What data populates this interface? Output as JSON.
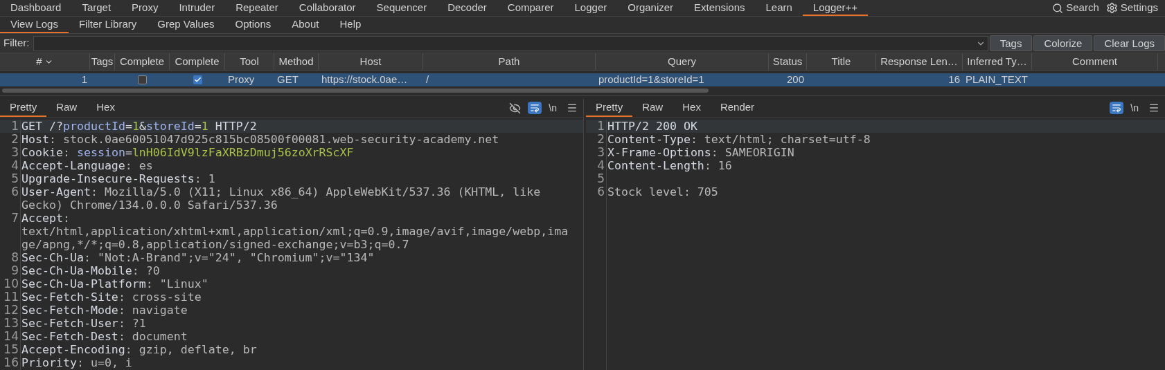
{
  "main_tabs": [
    {
      "label": "Dashboard",
      "selected": false
    },
    {
      "label": "Target",
      "selected": false
    },
    {
      "label": "Proxy",
      "selected": false
    },
    {
      "label": "Intruder",
      "selected": false
    },
    {
      "label": "Repeater",
      "selected": false
    },
    {
      "label": "Collaborator",
      "selected": false
    },
    {
      "label": "Sequencer",
      "selected": false
    },
    {
      "label": "Decoder",
      "selected": false
    },
    {
      "label": "Comparer",
      "selected": false
    },
    {
      "label": "Logger",
      "selected": false
    },
    {
      "label": "Organizer",
      "selected": false
    },
    {
      "label": "Extensions",
      "selected": false
    },
    {
      "label": "Learn",
      "selected": false
    },
    {
      "label": "Logger++",
      "selected": true
    }
  ],
  "top_actions": [
    {
      "kind": "search",
      "label": "Search"
    },
    {
      "kind": "settings",
      "label": "Settings"
    }
  ],
  "sub_tabs": [
    {
      "label": "View Logs",
      "selected": true
    },
    {
      "label": "Filter Library",
      "selected": false
    },
    {
      "label": "Grep Values",
      "selected": false
    },
    {
      "label": "Options",
      "selected": false
    },
    {
      "label": "About",
      "selected": false
    },
    {
      "label": "Help",
      "selected": false
    }
  ],
  "filter": {
    "label": "Filter:",
    "buttons": [
      "Tags",
      "Colorize",
      "Clear Logs"
    ]
  },
  "table": {
    "columns": [
      {
        "label": "#",
        "sorted": true
      },
      {
        "label": "Tags",
        "sorted": false
      },
      {
        "label": "Complete",
        "sorted": false
      },
      {
        "label": "Complete",
        "sorted": false
      },
      {
        "label": "Tool",
        "sorted": false
      },
      {
        "label": "Method",
        "sorted": false
      },
      {
        "label": "Host",
        "sorted": false
      },
      {
        "label": "Path",
        "sorted": false
      },
      {
        "label": "Query",
        "sorted": false
      },
      {
        "label": "Status",
        "sorted": false
      },
      {
        "label": "Title",
        "sorted": false
      },
      {
        "label": "Response Len…",
        "sorted": false
      },
      {
        "label": "Inferred Ty…",
        "sorted": false
      },
      {
        "label": "Comment",
        "sorted": false
      }
    ],
    "rows": [
      {
        "selected": true,
        "cells": [
          {
            "kind": "num",
            "text": "1"
          },
          {
            "kind": "empty"
          },
          {
            "kind": "check",
            "checked": false
          },
          {
            "kind": "check",
            "checked": true
          },
          {
            "kind": "text",
            "text": "Proxy"
          },
          {
            "kind": "text",
            "text": "GET"
          },
          {
            "kind": "text",
            "text": "https://stock.0ae…"
          },
          {
            "kind": "text",
            "text": "/"
          },
          {
            "kind": "text",
            "text": "productId=1&storeId=1"
          },
          {
            "kind": "num",
            "text": "200"
          },
          {
            "kind": "empty"
          },
          {
            "kind": "num",
            "text": "16"
          },
          {
            "kind": "text",
            "text": "PLAIN_TEXT"
          },
          {
            "kind": "empty"
          }
        ]
      }
    ]
  },
  "request": {
    "tabs": [
      {
        "label": "Pretty",
        "selected": true
      },
      {
        "label": "Raw",
        "selected": false
      },
      {
        "label": "Hex",
        "selected": false
      }
    ],
    "hide_icon": true,
    "wrap_on": true,
    "newline_toggle": "\\n",
    "lines": [
      {
        "number": "1",
        "segments": [
          {
            "kind": "name",
            "text": "GET /?"
          },
          {
            "kind": "param",
            "text": "productId"
          },
          {
            "kind": "name",
            "text": "="
          },
          {
            "kind": "pval",
            "text": "1"
          },
          {
            "kind": "name",
            "text": "&"
          },
          {
            "kind": "param",
            "text": "storeId"
          },
          {
            "kind": "name",
            "text": "="
          },
          {
            "kind": "pval",
            "text": "1"
          },
          {
            "kind": "name",
            "text": " HTTP/2"
          }
        ]
      },
      {
        "number": "2",
        "segments": [
          {
            "kind": "name",
            "text": "Host"
          },
          {
            "kind": "value",
            "text": ": stock.0ae60051047d925c815bc08500f00081.web-security-academy.net"
          }
        ]
      },
      {
        "number": "3",
        "segments": [
          {
            "kind": "name",
            "text": "Cookie"
          },
          {
            "kind": "value",
            "text": ": "
          },
          {
            "kind": "param",
            "text": "session"
          },
          {
            "kind": "name",
            "text": "="
          },
          {
            "kind": "pval",
            "text": "lnH06IdV9lzFaXRBzDmuj56zoXrRScXF"
          }
        ]
      },
      {
        "number": "4",
        "segments": [
          {
            "kind": "name",
            "text": "Accept-Language"
          },
          {
            "kind": "value",
            "text": ": es"
          }
        ]
      },
      {
        "number": "5",
        "segments": [
          {
            "kind": "name",
            "text": "Upgrade-Insecure-Requests"
          },
          {
            "kind": "value",
            "text": ": 1"
          }
        ]
      },
      {
        "number": "6",
        "segments": [
          {
            "kind": "name",
            "text": "User-Agent"
          },
          {
            "kind": "value",
            "text": ": Mozilla/5.0 (X11; Linux x86_64) AppleWebKit/537.36 (KHTML, like Gecko) Chrome/134.0.0.0 Safari/537.36"
          }
        ]
      },
      {
        "number": "7",
        "segments": [
          {
            "kind": "name",
            "text": "Accept"
          },
          {
            "kind": "value",
            "text": ": text/html,application/xhtml+xml,application/xml;q=0.9,image/avif,image/webp,image/apng,*/*;q=0.8,application/signed-exchange;v=b3;q=0.7"
          }
        ]
      },
      {
        "number": "8",
        "segments": [
          {
            "kind": "name",
            "text": "Sec-Ch-Ua"
          },
          {
            "kind": "value",
            "text": ": \"Not:A-Brand\";v=\"24\", \"Chromium\";v=\"134\""
          }
        ]
      },
      {
        "number": "9",
        "segments": [
          {
            "kind": "name",
            "text": "Sec-Ch-Ua-Mobile"
          },
          {
            "kind": "value",
            "text": ": ?0"
          }
        ]
      },
      {
        "number": "10",
        "segments": [
          {
            "kind": "name",
            "text": "Sec-Ch-Ua-Platform"
          },
          {
            "kind": "value",
            "text": ": \"Linux\""
          }
        ]
      },
      {
        "number": "11",
        "segments": [
          {
            "kind": "name",
            "text": "Sec-Fetch-Site"
          },
          {
            "kind": "value",
            "text": ": cross-site"
          }
        ]
      },
      {
        "number": "12",
        "segments": [
          {
            "kind": "name",
            "text": "Sec-Fetch-Mode"
          },
          {
            "kind": "value",
            "text": ": navigate"
          }
        ]
      },
      {
        "number": "13",
        "segments": [
          {
            "kind": "name",
            "text": "Sec-Fetch-User"
          },
          {
            "kind": "value",
            "text": ": ?1"
          }
        ]
      },
      {
        "number": "14",
        "segments": [
          {
            "kind": "name",
            "text": "Sec-Fetch-Dest"
          },
          {
            "kind": "value",
            "text": ": document"
          }
        ]
      },
      {
        "number": "15",
        "segments": [
          {
            "kind": "name",
            "text": "Accept-Encoding"
          },
          {
            "kind": "value",
            "text": ": gzip, deflate, br"
          }
        ]
      },
      {
        "number": "16",
        "segments": [
          {
            "kind": "name",
            "text": "Priority"
          },
          {
            "kind": "value",
            "text": ": u=0, i"
          }
        ]
      }
    ]
  },
  "response": {
    "tabs": [
      {
        "label": "Pretty",
        "selected": true
      },
      {
        "label": "Raw",
        "selected": false
      },
      {
        "label": "Hex",
        "selected": false
      },
      {
        "label": "Render",
        "selected": false
      }
    ],
    "wrap_on": true,
    "newline_toggle": "\\n",
    "lines": [
      {
        "number": "1",
        "segments": [
          {
            "kind": "name",
            "text": "HTTP/2 200 OK"
          }
        ]
      },
      {
        "number": "2",
        "segments": [
          {
            "kind": "name",
            "text": "Content-Type"
          },
          {
            "kind": "value",
            "text": ": text/html; charset=utf-8"
          }
        ]
      },
      {
        "number": "3",
        "segments": [
          {
            "kind": "name",
            "text": "X-Frame-Options"
          },
          {
            "kind": "value",
            "text": ": SAMEORIGIN"
          }
        ]
      },
      {
        "number": "4",
        "segments": [
          {
            "kind": "name",
            "text": "Content-Length"
          },
          {
            "kind": "value",
            "text": ": 16"
          }
        ]
      },
      {
        "number": "5"
      },
      {
        "number": "6",
        "segments": [
          {
            "kind": "value",
            "text": "Stock level: 705"
          }
        ]
      }
    ]
  }
}
